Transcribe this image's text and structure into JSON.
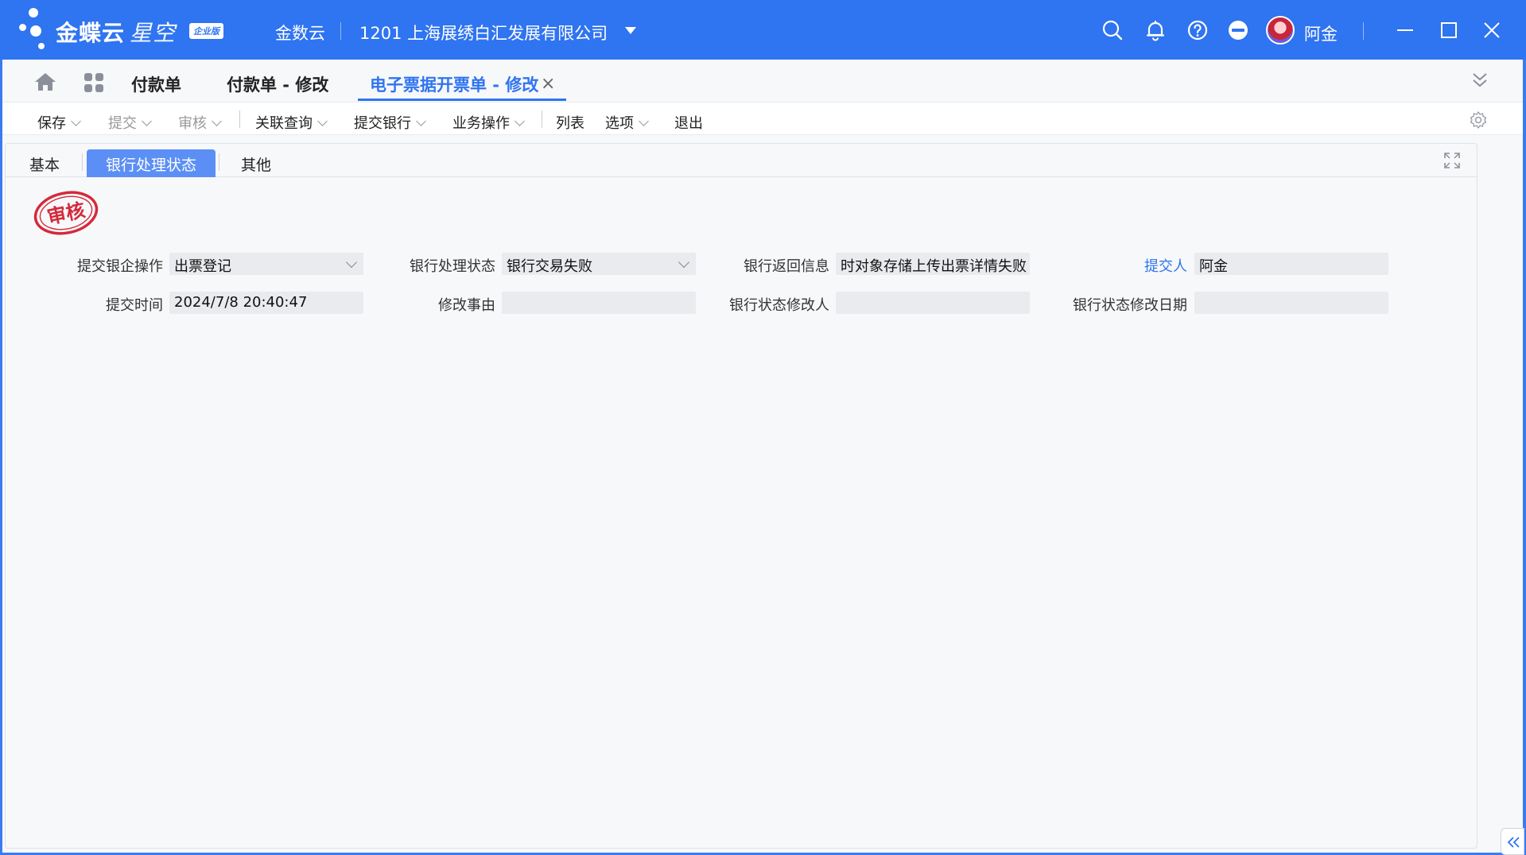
{
  "titlebar": {
    "brand": "金蝶云",
    "brand_sub": "星空",
    "edition_badge": "企业版",
    "cloud_label": "金数云",
    "org": "1201  上海展绣白汇发展有限公司",
    "user_name": "阿金",
    "icons": [
      "search-icon",
      "bell-icon",
      "help-icon",
      "minus-circle-icon",
      "avatar",
      "minimize-icon",
      "maximize-icon",
      "close-icon"
    ]
  },
  "nav": {
    "tabs": [
      {
        "label": "付款单",
        "active": false
      },
      {
        "label": "付款单 - 修改",
        "active": false
      },
      {
        "label": "电子票据开票单 - 修改",
        "active": true
      }
    ],
    "close_symbol": "×"
  },
  "toolbar": {
    "items": [
      {
        "label": "保存",
        "dropdown": true,
        "disabled": false
      },
      {
        "label": "提交",
        "dropdown": true,
        "disabled": true
      },
      {
        "label": "审核",
        "dropdown": true,
        "disabled": true
      },
      {
        "label": "关联查询",
        "dropdown": true,
        "disabled": false
      },
      {
        "label": "提交银行",
        "dropdown": true,
        "disabled": false
      },
      {
        "label": "业务操作",
        "dropdown": true,
        "disabled": false
      },
      {
        "label": "列表",
        "dropdown": false,
        "disabled": false
      },
      {
        "label": "选项",
        "dropdown": true,
        "disabled": false
      },
      {
        "label": "退出",
        "dropdown": false,
        "disabled": false
      }
    ]
  },
  "subtabs": [
    {
      "label": "基本",
      "active": false
    },
    {
      "label": "银行处理状态",
      "active": true
    },
    {
      "label": "其他",
      "active": false
    }
  ],
  "stamp_text": "审核",
  "form": {
    "submit_bank_op_label": "提交银企操作",
    "submit_bank_op_value": "出票登记",
    "bank_status_label": "银行处理状态",
    "bank_status_value": "银行交易失败",
    "bank_return_label": "银行返回信息",
    "bank_return_value": "时对象存储上传出票详情失败",
    "submitter_label": "提交人",
    "submitter_value": "阿金",
    "submit_time_label": "提交时间",
    "submit_time_value": "2024/7/8 20:40:47",
    "modify_reason_label": "修改事由",
    "modify_reason_value": "",
    "status_modifier_label": "银行状态修改人",
    "status_modifier_value": "",
    "status_modify_date_label": "银行状态修改日期",
    "status_modify_date_value": ""
  },
  "colors": {
    "brand_blue": "#2f74f0",
    "active_subtab": "#5b8ff5",
    "stamp_red": "#d42a3a"
  }
}
